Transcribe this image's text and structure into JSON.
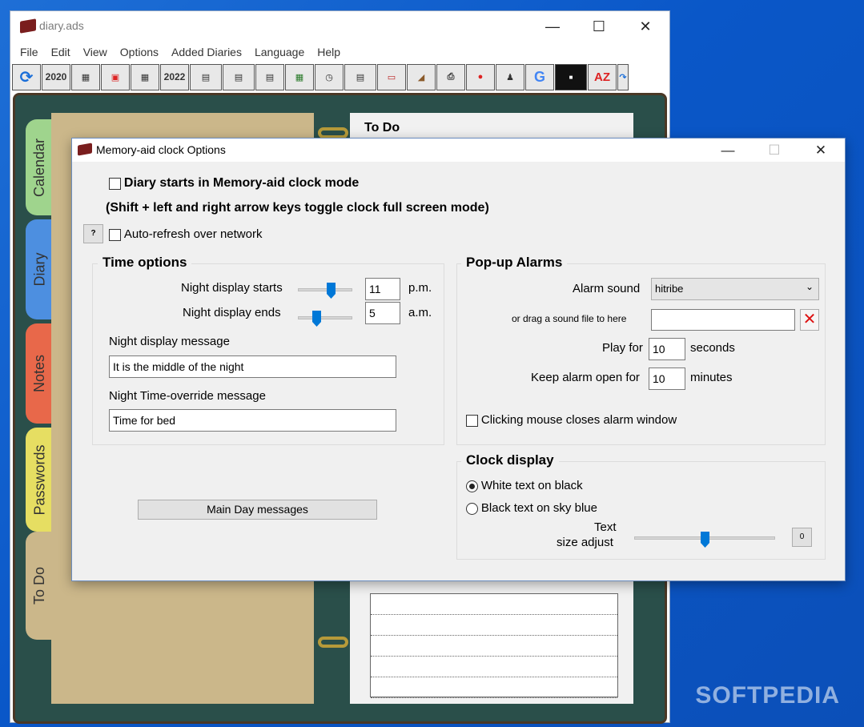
{
  "main": {
    "title": "diary.ads",
    "menu": [
      "File",
      "Edit",
      "View",
      "Options",
      "Added Diaries",
      "Language",
      "Help"
    ],
    "year_prev": "2020",
    "year_next": "2022",
    "todo_title": "To Do",
    "tabs": [
      "Calendar",
      "Diary",
      "Notes",
      "Passwords",
      "To Do"
    ]
  },
  "dialog": {
    "title": "Memory-aid clock Options",
    "diary_starts_label": "Diary starts in Memory-aid clock mode",
    "shift_note": "(Shift + left and right arrow keys toggle clock full screen mode)",
    "help_button": "?",
    "auto_refresh_label": "Auto-refresh over network",
    "time_options": {
      "title": "Time options",
      "night_starts_label": "Night display starts",
      "night_starts_value": "11",
      "night_starts_ampm": "p.m.",
      "night_ends_label": "Night display ends",
      "night_ends_value": "5",
      "night_ends_ampm": "a.m.",
      "night_msg_label": "Night display message",
      "night_msg_value": "It is the middle of the night",
      "override_label": "Night Time-override message",
      "override_value": "Time for bed"
    },
    "main_day_button": "Main Day messages",
    "popup": {
      "title": "Pop-up Alarms",
      "alarm_sound_label": "Alarm sound",
      "alarm_sound_value": "hitribe",
      "drag_label": "or drag a sound file to here",
      "play_for_label": "Play for",
      "play_for_value": "10",
      "play_for_unit": "seconds",
      "keep_open_label": "Keep alarm open for",
      "keep_open_value": "10",
      "keep_open_unit": "minutes",
      "click_closes_label": "Clicking mouse closes alarm window"
    },
    "clock": {
      "title": "Clock display",
      "opt1": "White text on black",
      "opt2": "Black text on sky blue",
      "text_label1": "Text",
      "text_label2": "size adjust",
      "size_value": "0"
    }
  },
  "watermark": "SOFTPEDIA"
}
